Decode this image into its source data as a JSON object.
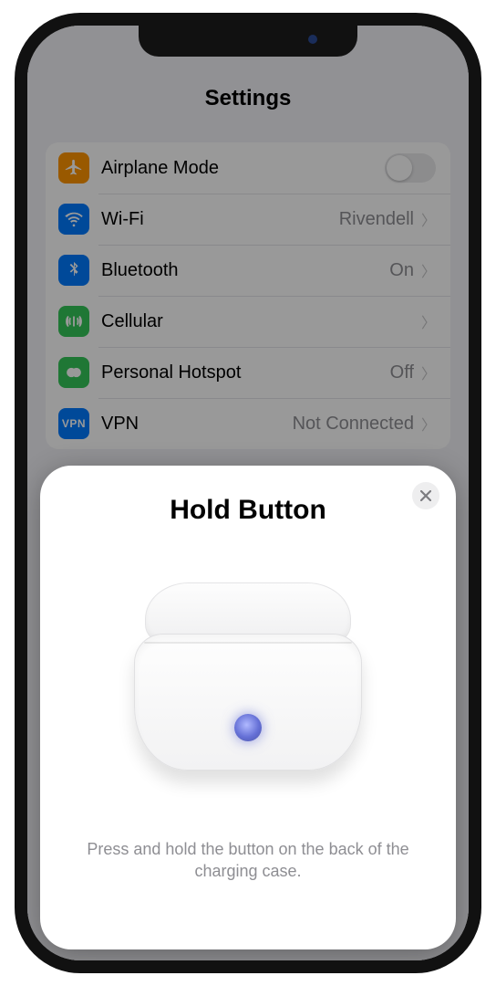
{
  "header": {
    "title": "Settings"
  },
  "rows": {
    "airplane": {
      "label": "Airplane Mode"
    },
    "wifi": {
      "label": "Wi-Fi",
      "value": "Rivendell"
    },
    "bt": {
      "label": "Bluetooth",
      "value": "On"
    },
    "cell": {
      "label": "Cellular"
    },
    "hotspot": {
      "label": "Personal Hotspot",
      "value": "Off"
    },
    "vpn": {
      "label": "VPN",
      "icon_text": "VPN",
      "value": "Not Connected"
    }
  },
  "sheet": {
    "title": "Hold Button",
    "instruction": "Press and hold the button on the back of the charging case."
  }
}
